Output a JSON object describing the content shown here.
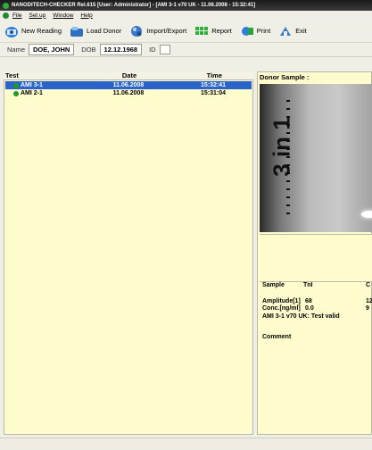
{
  "window": {
    "title": "NANODITECH-CHECKER Rel.615 [User: Administrator] - [AMI 3-1 v70 UK - 11.06.2008 - 15:32:41]"
  },
  "menu": [
    "File",
    "Set up",
    "Window",
    "Help"
  ],
  "toolbar": [
    {
      "label": "New Reading",
      "icon": "new-reading-icon"
    },
    {
      "label": "Load Donor",
      "icon": "load-donor-icon"
    },
    {
      "label": "Import/Export",
      "icon": "import-export-icon"
    },
    {
      "label": "Report",
      "icon": "report-icon"
    },
    {
      "label": "Print",
      "icon": "print-icon"
    },
    {
      "label": "Exit",
      "icon": "exit-icon"
    }
  ],
  "patient": {
    "name_label": "Name",
    "name": "DOE, JOHN",
    "dob_label": "DOB",
    "dob": "12.12.1968",
    "id_label": "ID",
    "id": ""
  },
  "tests": {
    "headers": {
      "test": "Test",
      "date": "Date",
      "time": "Time"
    },
    "rows": [
      {
        "test": "AMI 3-1",
        "date": "11.06.2008",
        "time": "15:32:41",
        "selected": true
      },
      {
        "test": "AMI 2-1",
        "date": "11.06.2008",
        "time": "15:31:04",
        "selected": false
      }
    ]
  },
  "donor": {
    "title": "Donor Sample :",
    "image_text": "3 in 1",
    "results": {
      "headers": {
        "sample": "Sample",
        "tnl": "TnI",
        "c": "C"
      },
      "amplitude_label": "Amplitude[1]",
      "amplitude_tni": "68",
      "amplitude_c": "12",
      "conc_label": "Conc.[ng/ml]",
      "conc_tni": "0.0",
      "conc_c": "9",
      "validity": "AMI 3-1 v70 UK:  Test valid",
      "comment_label": "Comment"
    }
  },
  "colors": {
    "selection": "#2a63c9",
    "panel": "#fefccc",
    "titlebar": "#1b1b1b",
    "status_dot": "#1d9b27"
  }
}
